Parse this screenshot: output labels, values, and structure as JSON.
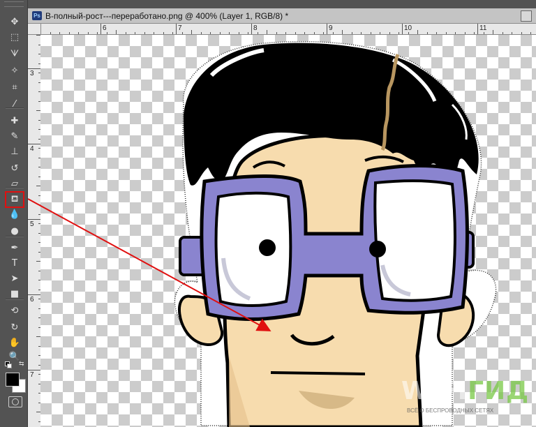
{
  "document": {
    "tab_title": "В-полный-рост---переработано.png @ 400% (Layer 1, RGB/8) *",
    "app_icon": "Ps"
  },
  "rulers": {
    "horizontal": [
      "6",
      "7",
      "8",
      "9",
      "10",
      "11"
    ],
    "vertical": [
      "3",
      "4",
      "5",
      "6",
      "7"
    ]
  },
  "tools": [
    {
      "name": "move-tool-icon",
      "glyph": "✥"
    },
    {
      "name": "marquee-tool-icon",
      "glyph": "⬚"
    },
    {
      "name": "lasso-tool-icon",
      "glyph": "ᗐ"
    },
    {
      "name": "magic-wand-tool-icon",
      "glyph": "✧"
    },
    {
      "name": "crop-tool-icon",
      "glyph": "⌗"
    },
    {
      "name": "eyedropper-tool-icon",
      "glyph": "⁄"
    },
    {
      "name": "healing-brush-tool-icon",
      "glyph": "✚"
    },
    {
      "name": "brush-tool-icon",
      "glyph": "✎"
    },
    {
      "name": "clone-stamp-tool-icon",
      "glyph": "⊥"
    },
    {
      "name": "history-brush-tool-icon",
      "glyph": "↺"
    },
    {
      "name": "eraser-tool-icon",
      "glyph": "▱"
    },
    {
      "name": "paint-bucket-tool-icon",
      "glyph": "⛾"
    },
    {
      "name": "blur-tool-icon",
      "glyph": "💧"
    },
    {
      "name": "dodge-tool-icon",
      "glyph": "●"
    },
    {
      "name": "pen-tool-icon",
      "glyph": "✒"
    },
    {
      "name": "type-tool-icon",
      "glyph": "T"
    },
    {
      "name": "path-selection-tool-icon",
      "glyph": "➤"
    },
    {
      "name": "shape-tool-icon",
      "glyph": "■"
    },
    {
      "name": "3d-rotate-tool-icon",
      "glyph": "⟲"
    },
    {
      "name": "3d-orbit-tool-icon",
      "glyph": "↻"
    },
    {
      "name": "hand-tool-icon",
      "glyph": "✋"
    },
    {
      "name": "zoom-tool-icon",
      "glyph": "🔍"
    }
  ],
  "colors": {
    "foreground": "#000000",
    "background": "#ffffff",
    "highlight": "#e01010",
    "glasses": "#8a84cf",
    "skin": "#f7dcae"
  },
  "watermark": {
    "main_prefix": "WIFI",
    "main_suffix": "ГИД",
    "sub": "ВСЁ О БЕСПРОВОДНЫХ СЕТЯХ"
  }
}
